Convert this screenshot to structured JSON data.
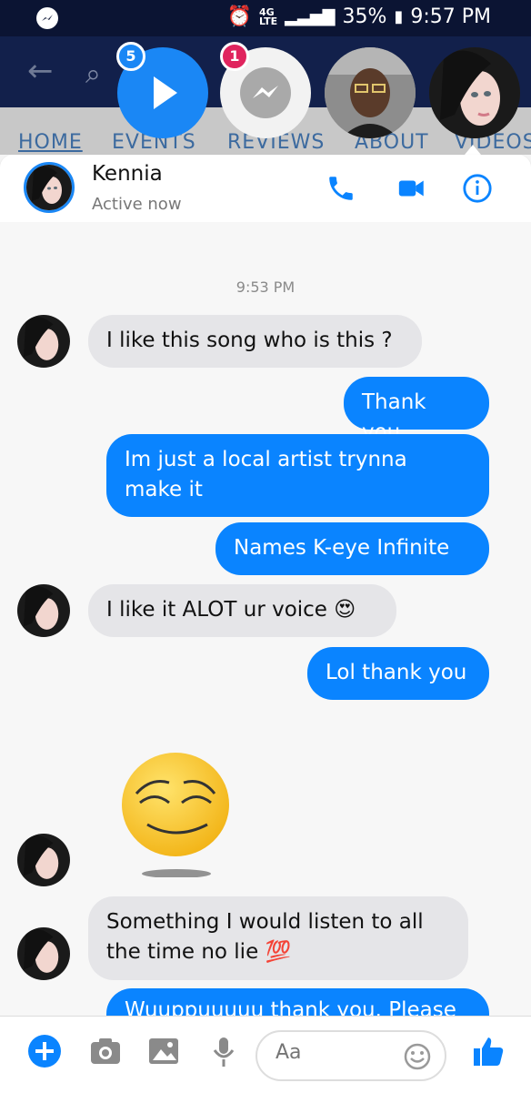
{
  "status": {
    "network": "4G",
    "lte": "LTE",
    "battery": "35%",
    "time": "9:57 PM"
  },
  "background_page": {
    "tabs": [
      "HOME",
      "EVENTS",
      "REVIEWS",
      "ABOUT",
      "VIDEOS"
    ]
  },
  "chat_heads": {
    "video_badge": "5",
    "messenger_badge": "1"
  },
  "conversation": {
    "name": "Kennia",
    "status": "Active now",
    "timestamp": "9:53 PM",
    "messages": [
      {
        "from": "them",
        "text": "I like this song who is this ?"
      },
      {
        "from": "me",
        "text": "Thank you"
      },
      {
        "from": "me",
        "text": "Im just a local artist trynna make it"
      },
      {
        "from": "me",
        "text": "Names K-eye Infinite"
      },
      {
        "from": "them",
        "text": "I like it ALOT ur voice 😍"
      },
      {
        "from": "me",
        "text": "Lol thank you"
      },
      {
        "from": "them",
        "text": "Something I would listen to all the time no lie 💯"
      },
      {
        "from": "me",
        "text": "Wuuppuuuuu thank you. Please"
      }
    ]
  },
  "composer": {
    "placeholder": "Aa"
  },
  "colors": {
    "accent": "#0a84ff",
    "incoming_bubble": "#e5e5e8",
    "header_dark": "#12204b"
  }
}
